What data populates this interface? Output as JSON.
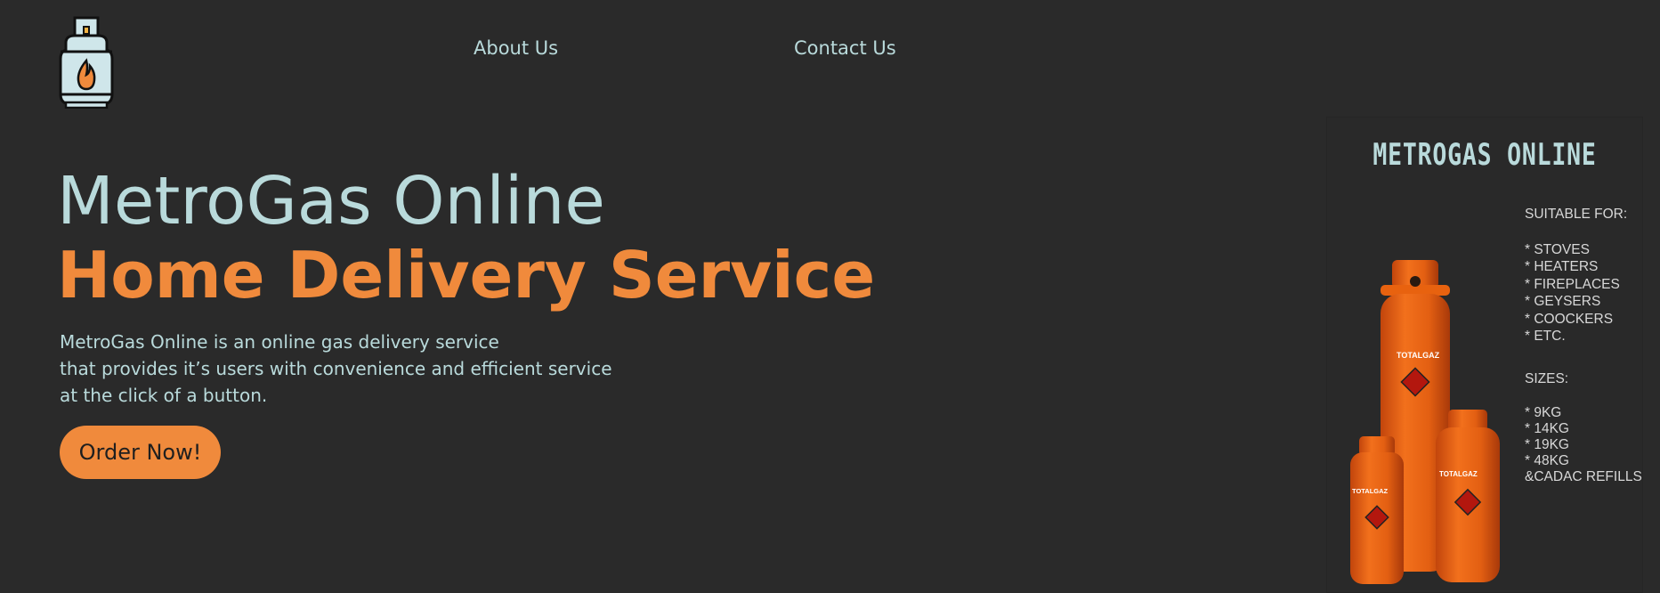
{
  "header": {
    "logo_icon": "gas-cylinder-icon",
    "nav": [
      {
        "label": "About Us"
      },
      {
        "label": "Contact Us"
      }
    ]
  },
  "hero": {
    "title": "MetroGas Online",
    "subtitle": "Home Delivery Service",
    "description": [
      "MetroGas Online is an online gas delivery service",
      "that provides it’s users with convenience and efficient service",
      "at the click of a button."
    ],
    "cta_label": "Order Now!"
  },
  "ad": {
    "title": "METROGAS ONLINE",
    "suitable_heading": "SUITABLE FOR:",
    "suitable_items": [
      "* STOVES",
      "* HEATERS",
      "* FIREPLACES",
      "* GEYSERS",
      "* COOCKERS",
      "* ETC."
    ],
    "sizes_heading": "SIZES:",
    "sizes_items": [
      "* 9KG",
      "* 14KG",
      "* 19KG",
      "* 48KG",
      "&CADAC REFILLS"
    ],
    "cylinder_brand": "TOTALGAZ"
  },
  "colors": {
    "background": "#2a2a2a",
    "accent": "#f08a3c",
    "text": "#b9dadb"
  }
}
